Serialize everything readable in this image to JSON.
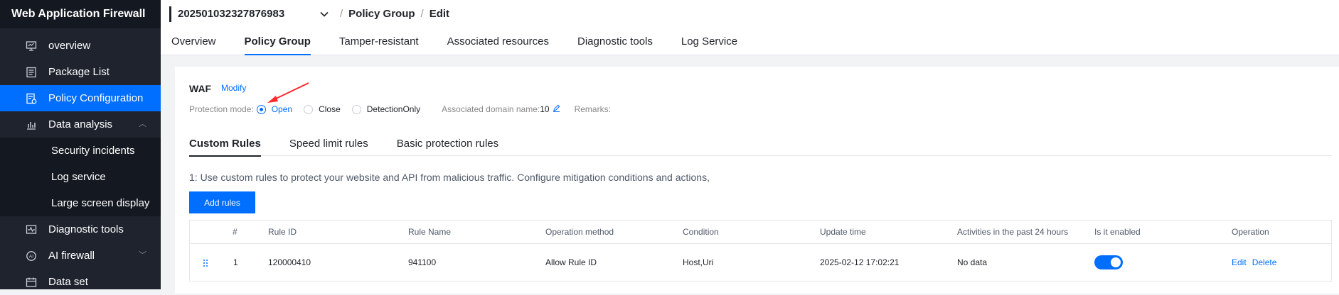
{
  "sidebar": {
    "title": "Web Application Firewall",
    "items": [
      {
        "label": "overview",
        "icon": "monitor-icon"
      },
      {
        "label": "Package List",
        "icon": "list-icon"
      },
      {
        "label": "Policy Configuration",
        "icon": "policy-icon",
        "active": true
      },
      {
        "label": "Data analysis",
        "icon": "chart-icon",
        "expanded": true
      },
      {
        "label": "Diagnostic tools",
        "icon": "diagnostic-icon"
      },
      {
        "label": "AI firewall",
        "icon": "ai-icon"
      },
      {
        "label": "Data set",
        "icon": "calendar-icon"
      }
    ],
    "sub_items": [
      "Security incidents",
      "Log service",
      "Large screen display"
    ]
  },
  "breadcrumb": {
    "instance": "202501032327876983",
    "section": "Policy Group",
    "page": "Edit"
  },
  "tabs": [
    "Overview",
    "Policy Group",
    "Tamper-resistant",
    "Associated resources",
    "Diagnostic tools",
    "Log Service"
  ],
  "waf": {
    "title": "WAF",
    "modify": "Modify",
    "protection_label": "Protection mode:",
    "options": [
      "Open",
      "Close",
      "DetectionOnly"
    ],
    "selected": "Open",
    "assoc_label": "Associated domain name:",
    "assoc_count": "10",
    "remarks_label": "Remarks:"
  },
  "subtabs": [
    "Custom Rules",
    "Speed limit rules",
    "Basic protection rules"
  ],
  "description": "1: Use custom rules to protect your website and API from malicious traffic. Configure mitigation conditions and actions,",
  "add_button": "Add rules",
  "table": {
    "headers": [
      "#",
      "Rule ID",
      "Rule Name",
      "Operation method",
      "Condition",
      "Update time",
      "Activities in the past 24 hours",
      "Is it enabled",
      "Operation"
    ],
    "rows": [
      {
        "num": "1",
        "rule_id": "120000410",
        "rule_name": "941100",
        "method": "Allow Rule ID",
        "condition": "Host,Uri",
        "update_time": "2025-02-12 17:02:21",
        "activity": "No data",
        "enabled": true,
        "edit": "Edit",
        "delete": "Delete"
      }
    ]
  },
  "colors": {
    "accent": "#006eff",
    "sidebar_bg": "#1e232e",
    "annotation_arrow": "#ff2a2a"
  }
}
